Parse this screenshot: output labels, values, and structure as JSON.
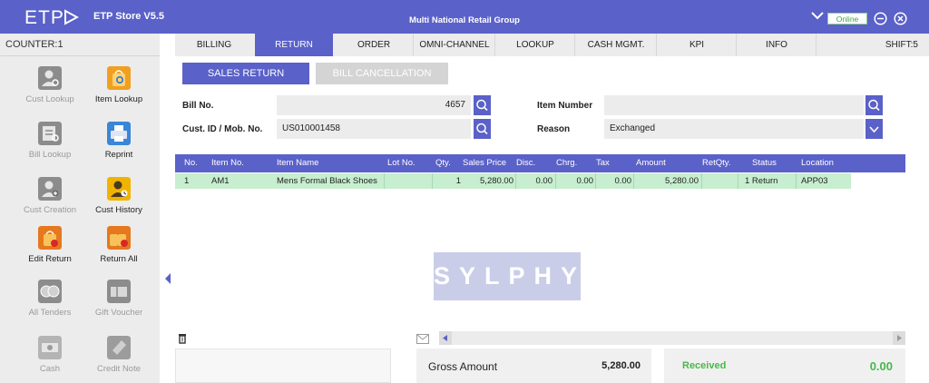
{
  "app": {
    "logo": "ETP",
    "store_name": "ETP Store V5.5",
    "company": "Multi National Retail Group",
    "online_status": "Online"
  },
  "sidebar": {
    "counter": "COUNTER:1",
    "buttons": [
      {
        "label": "Cust Lookup",
        "icon": "customer-lookup-icon"
      },
      {
        "label": "Item Lookup",
        "icon": "item-lookup-icon"
      },
      {
        "label": "Bill Lookup",
        "icon": "bill-lookup-icon"
      },
      {
        "label": "Reprint",
        "icon": "printer-icon"
      },
      {
        "label": "Cust Creation",
        "icon": "customer-creation-icon"
      },
      {
        "label": "Cust History",
        "icon": "customer-history-icon"
      },
      {
        "label": "Edit Return",
        "icon": "edit-return-icon"
      },
      {
        "label": "Return All",
        "icon": "return-all-icon"
      },
      {
        "label": "All Tenders",
        "icon": "tenders-icon"
      },
      {
        "label": "Gift Voucher",
        "icon": "gift-voucher-icon"
      },
      {
        "label": "Cash",
        "icon": "cash-icon"
      },
      {
        "label": "Credit Note",
        "icon": "credit-note-icon"
      }
    ]
  },
  "tabs": [
    "BILLING",
    "RETURN",
    "ORDER",
    "OMNI-CHANNEL",
    "LOOKUP",
    "CASH MGMT.",
    "KPI",
    "INFO"
  ],
  "shift": "SHIFT:5",
  "subtabs": {
    "active": "SALES RETURN",
    "inactive": "BILL CANCELLATION"
  },
  "form": {
    "bill_no_label": "Bill No.",
    "bill_no_value": "4657",
    "cust_label": "Cust. ID / Mob. No.",
    "cust_value": "US010001458",
    "item_number_label": "Item Number",
    "item_number_value": "",
    "reason_label": "Reason",
    "reason_value": "Exchanged"
  },
  "grid": {
    "headers": [
      "No.",
      "Item No.",
      "Item Name",
      "Lot No.",
      "Qty.",
      "Sales Price",
      "Disc.",
      "Chrg.",
      "Tax",
      "Amount",
      "RetQty.",
      "Status",
      "Location"
    ],
    "rows": [
      {
        "no": "1",
        "item_no": "AM1",
        "item_name": "Mens Formal Black Shoes",
        "lot_no": "",
        "qty": "1",
        "sales_price": "5,280.00",
        "disc": "0.00",
        "chrg": "0.00",
        "tax": "0.00",
        "amount": "5,280.00",
        "ret_qty": "",
        "status": "1 Return",
        "location": "APP03"
      }
    ]
  },
  "watermark": "SYLPHY",
  "totals": {
    "gross_label": "Gross Amount",
    "gross_value": "5,280.00",
    "received_label": "Received",
    "received_value": "0.00"
  },
  "colors": {
    "primary": "#5a61c8",
    "row_highlight": "#c6eecf",
    "received": "#47b84b"
  }
}
